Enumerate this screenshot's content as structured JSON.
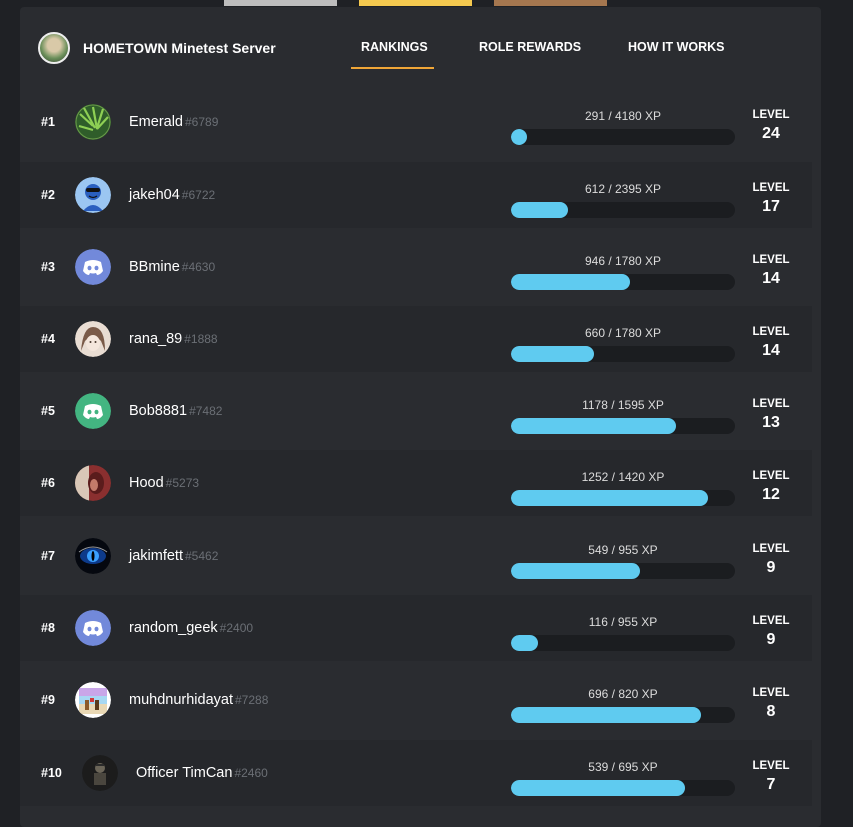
{
  "server": {
    "name": "HOMETOWN Minetest Server"
  },
  "nav": {
    "tabs": [
      {
        "label": "RANKINGS",
        "active": true
      },
      {
        "label": "ROLE REWARDS",
        "active": false
      },
      {
        "label": "HOW IT WORKS",
        "active": false
      }
    ]
  },
  "level_label": "LEVEL",
  "colors": {
    "active_underline": "#f0a637",
    "xp_bar": "#5fcbf0",
    "tag_gray": "#6b6f75"
  },
  "rankings": [
    {
      "rank": "#1",
      "name": "Emerald",
      "tag": "#6789",
      "xp_text": "291 / 4180 XP",
      "xp": 291,
      "xp_max": 4180,
      "level": "24",
      "avatar": "green-leaves-avatar"
    },
    {
      "rank": "#2",
      "name": "jakeh04",
      "tag": "#6722",
      "xp_text": "612 / 2395 XP",
      "xp": 612,
      "xp_max": 2395,
      "level": "17",
      "avatar": "blue-cool-face-avatar"
    },
    {
      "rank": "#3",
      "name": "BBmine",
      "tag": "#4630",
      "xp_text": "946 / 1780 XP",
      "xp": 946,
      "xp_max": 1780,
      "level": "14",
      "avatar": "discord-default-blurple-avatar"
    },
    {
      "rank": "#4",
      "name": "rana_89",
      "tag": "#1888",
      "xp_text": "660 / 1780 XP",
      "xp": 660,
      "xp_max": 1780,
      "level": "14",
      "avatar": "anime-girl-avatar"
    },
    {
      "rank": "#5",
      "name": "Bob8881",
      "tag": "#7482",
      "xp_text": "1178 / 1595 XP",
      "xp": 1178,
      "xp_max": 1595,
      "level": "13",
      "avatar": "discord-default-green-avatar"
    },
    {
      "rank": "#6",
      "name": "Hood",
      "tag": "#5273",
      "xp_text": "1252 / 1420 XP",
      "xp": 1252,
      "xp_max": 1420,
      "level": "12",
      "avatar": "red-portrait-avatar"
    },
    {
      "rank": "#7",
      "name": "jakimfett",
      "tag": "#5462",
      "xp_text": "549 / 955 XP",
      "xp": 549,
      "xp_max": 955,
      "level": "9",
      "avatar": "blue-eye-avatar"
    },
    {
      "rank": "#8",
      "name": "random_geek",
      "tag": "#2400",
      "xp_text": "116 / 955 XP",
      "xp": 116,
      "xp_max": 955,
      "level": "9",
      "avatar": "discord-default-blurple-avatar"
    },
    {
      "rank": "#9",
      "name": "muhdnurhidayat",
      "tag": "#7288",
      "xp_text": "696 / 820 XP",
      "xp": 696,
      "xp_max": 820,
      "level": "8",
      "avatar": "pixel-scene-avatar"
    },
    {
      "rank": "#10",
      "name": "Officer TimCan",
      "tag": "#2460",
      "xp_text": "539 / 695 XP",
      "xp": 539,
      "xp_max": 695,
      "level": "7",
      "avatar": "dark-figure-avatar"
    }
  ]
}
